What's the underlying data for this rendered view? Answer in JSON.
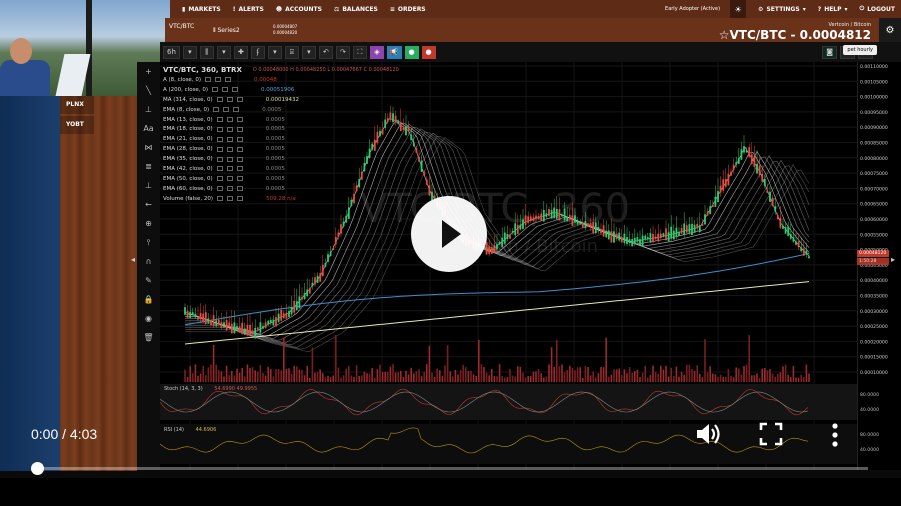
{
  "nav": {
    "items": [
      {
        "name": "markets",
        "label": "MARKETS",
        "icon": "bar-chart-icon"
      },
      {
        "name": "alerts",
        "label": "ALERTS",
        "icon": "exclamation-icon"
      },
      {
        "name": "accounts",
        "label": "ACCOUNTS",
        "icon": "people-icon"
      },
      {
        "name": "balances",
        "label": "BALANCES",
        "icon": "scale-icon"
      },
      {
        "name": "orders",
        "label": "ORDERS",
        "icon": "list-icon"
      }
    ],
    "plan": "Early Adopter (Active)",
    "settings": "SETTINGS",
    "help": "HELP",
    "logout": "LOGOUT"
  },
  "pairs": [
    "PLNX",
    "YOBT"
  ],
  "ticker": {
    "symbol": "VTC/BTC",
    "series_label": "Series2",
    "ohlc_line1": "0.00004807",
    "ohlc_line2": "0.00004820",
    "header_sub": "Vertcoin / Bitcoin",
    "header_main": "☆VTC/BTC - 0.0004812"
  },
  "toolbar": {
    "interval": "6h",
    "tooltip": "pet hourly"
  },
  "legend": {
    "title": "VTC/BTC, 360, BTRX",
    "ohlc": "O 0.00048000  H 0.00048250  L 0.00047667  C 0.00048120",
    "rows": [
      {
        "label": "A (8, close, 0)",
        "value": "0.00048",
        "color": "#c0392b"
      },
      {
        "label": "A (200, close, 0)",
        "value": "0.00051906",
        "color": "#4ea3e0"
      },
      {
        "label": "MA (314, close, 0)",
        "value": "0.00019432",
        "color": "#dede9a"
      },
      {
        "label": "EMA (8, close, 0)",
        "value": "0.0005",
        "color": "#888"
      },
      {
        "label": "EMA (13, close, 0)",
        "value": "0.0005",
        "color": "#888"
      },
      {
        "label": "EMA (18, close, 0)",
        "value": "0.0005",
        "color": "#888"
      },
      {
        "label": "EMA (21, close, 0)",
        "value": "0.0005",
        "color": "#888"
      },
      {
        "label": "EMA (28, close, 0)",
        "value": "0.0005",
        "color": "#888"
      },
      {
        "label": "EMA (35, close, 0)",
        "value": "0.0005",
        "color": "#888"
      },
      {
        "label": "EMA (42, close, 0)",
        "value": "0.0005",
        "color": "#888"
      },
      {
        "label": "EMA (50, close, 0)",
        "value": "0.0005",
        "color": "#888"
      },
      {
        "label": "EMA (60, close, 0)",
        "value": "0.0005",
        "color": "#888"
      },
      {
        "label": "Volume (false, 20)",
        "value": "509.28  n/a",
        "color": "#c0392b"
      }
    ]
  },
  "indicators": {
    "stoch": "Stoch (14, 3, 3)",
    "stoch_vals": "54.6990  49.9955",
    "rsi": "RSI (14)",
    "rsi_val": "44.6906"
  },
  "axis": {
    "ticks": [
      "0.00110000",
      "0.00105000",
      "0.00100000",
      "0.00095000",
      "0.00090000",
      "0.00085000",
      "0.00080000",
      "0.00075000",
      "0.00070000",
      "0.00065000",
      "0.00060000",
      "0.00055000",
      "0.00050000",
      "0.00045000",
      "0.00040000",
      "0.00035000",
      "0.00030000",
      "0.00025000",
      "0.00020000",
      "0.00015000",
      "0.00010000"
    ],
    "last_price": "0.00048120",
    "countdown": "1:50:28",
    "stoch_ticks": [
      "80.0000",
      "40.0000"
    ],
    "rsi_ticks": [
      "80.0000",
      "40.0000"
    ]
  },
  "watermark": {
    "line1": "VTC/BTC, 360",
    "line2": "Vertcoin / Bitcoin"
  },
  "video": {
    "time": "0:00 / 4:03"
  }
}
